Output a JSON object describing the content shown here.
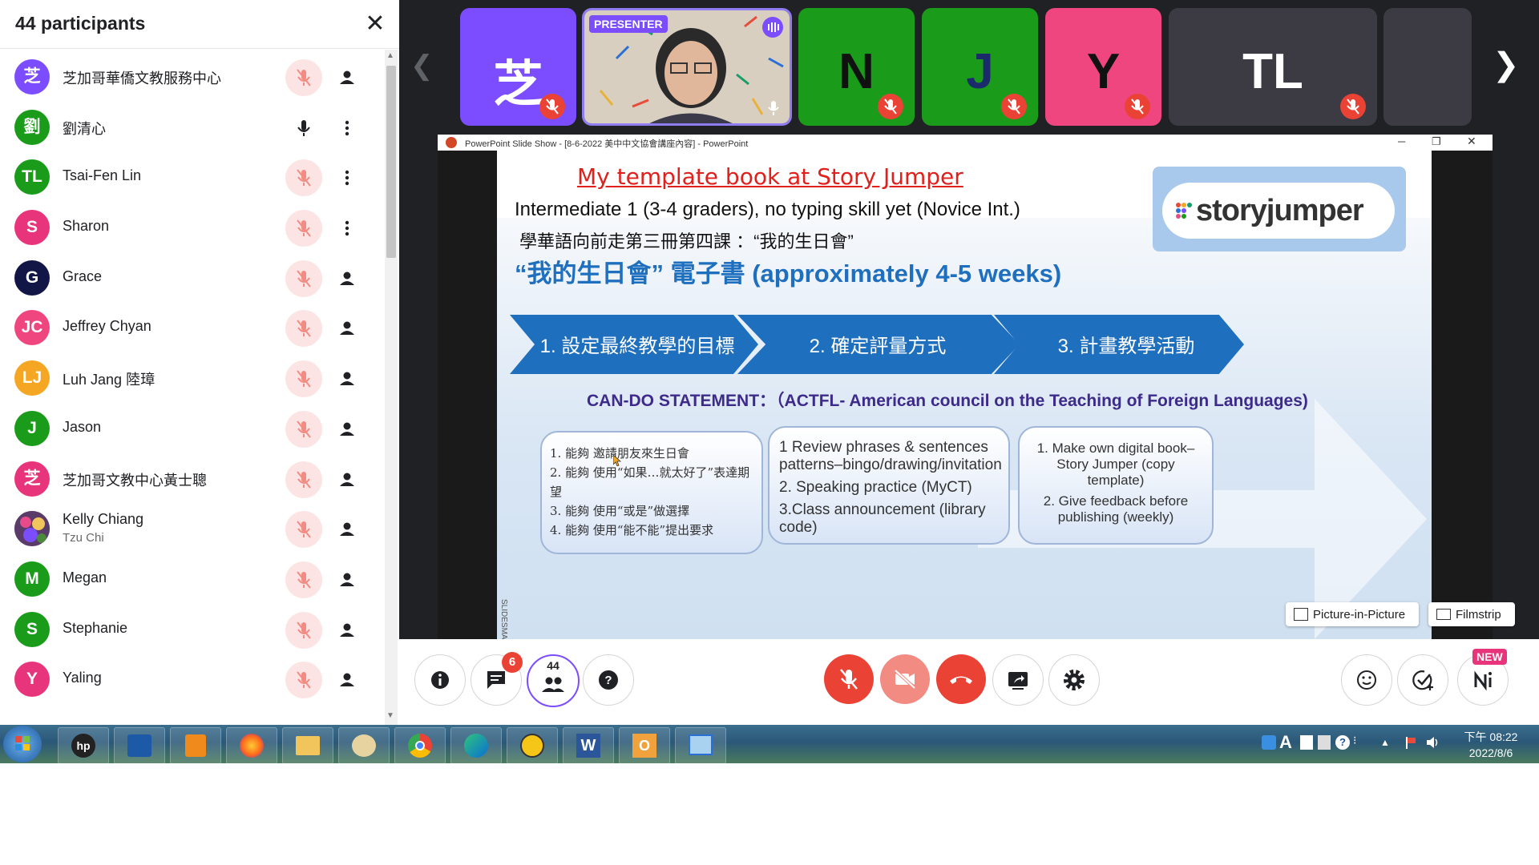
{
  "participants_panel": {
    "title": "44 participants",
    "participants": [
      {
        "initials": "芝",
        "name": "芝加哥華僑文教服務中心",
        "color": "#7c4dff",
        "muted": true,
        "action": "person"
      },
      {
        "initials": "劉",
        "name": "劉清心",
        "color": "#1a9b1a",
        "muted": false,
        "action": "more"
      },
      {
        "initials": "TL",
        "name": "Tsai-Fen Lin",
        "color": "#1a9b1a",
        "muted": true,
        "action": "more"
      },
      {
        "initials": "S",
        "name": "Sharon",
        "color": "#e8347a",
        "muted": true,
        "action": "more"
      },
      {
        "initials": "G",
        "name": "Grace",
        "color": "#111647",
        "muted": true,
        "action": "person"
      },
      {
        "initials": "JC",
        "name": "Jeffrey Chyan",
        "color": "#f0467f",
        "muted": true,
        "action": "person"
      },
      {
        "initials": "LJ",
        "name": "Luh Jang 陸璋",
        "color": "#f5a623",
        "muted": true,
        "action": "person"
      },
      {
        "initials": "J",
        "name": "Jason",
        "color": "#1a9b1a",
        "muted": true,
        "action": "person"
      },
      {
        "initials": "芝",
        "name": "芝加哥文教中心黃士聰",
        "color": "#e8347a",
        "muted": true,
        "action": "person"
      },
      {
        "initials": "",
        "name": "Kelly Chiang",
        "subtitle": "Tzu Chi",
        "color": "#6b4a7a",
        "muted": true,
        "action": "person",
        "photo": true
      },
      {
        "initials": "M",
        "name": "Megan",
        "color": "#1a9b1a",
        "muted": true,
        "action": "person"
      },
      {
        "initials": "S",
        "name": "Stephanie",
        "color": "#1a9b1a",
        "muted": true,
        "action": "person"
      },
      {
        "initials": "Y",
        "name": "Yaling",
        "color": "#e8347a",
        "muted": true,
        "action": "person"
      }
    ]
  },
  "filmstrip": {
    "tiles": [
      {
        "letter": "芝",
        "bg": "#7c4dff",
        "fg": "#ffffff",
        "muted": true
      },
      {
        "badge": "PRESENTER",
        "presenter": true
      },
      {
        "letter": "N",
        "bg": "#1a9b1a",
        "fg": "#111111",
        "muted": true
      },
      {
        "letter": "J",
        "bg": "#1a9b1a",
        "fg": "#1a2a6b",
        "muted": true
      },
      {
        "letter": "Y",
        "bg": "#f0467f",
        "fg": "#111111",
        "muted": true
      },
      {
        "letter": "TL",
        "bg": "#3c3b44",
        "fg": "#ffffff",
        "muted": true
      }
    ]
  },
  "ppt": {
    "window_title": "PowerPoint Slide Show - [8-6-2022 美中中文協會講座內容] - PowerPoint",
    "slide": {
      "heading": "My template book at Story Jumper",
      "line1": "Intermediate 1 (3-4 graders), no typing skill yet (Novice Int.)",
      "line2": "學華語向前走第三冊第四課 ：“我的生日會”",
      "line3": "“我的生日會” 電子書  (approximately 4-5 weeks)",
      "logo_text": "storyjumper",
      "steps": [
        "1. 設定最終教學的目標",
        "2. 確定評量方式",
        "3. 計畫教學活動"
      ],
      "can_do": "CAN-DO STATEMENT：（ACTFL- American council on the Teaching of Foreign Languages)",
      "box1": [
        "1. 能夠 邀請朋友來生日會",
        "2. 能夠 使用“如果…就太好了”表達期望",
        "3. 能夠 使用“或是”做選擇",
        "4. 能夠 使用“能不能”提出要求"
      ],
      "box2": [
        "1 Review phrases & sentences patterns–bingo/drawing/invitation",
        "2. Speaking practice (MyCT)",
        "3.Class announcement (library code)"
      ],
      "box3": [
        "1. Make own digital book–Story Jumper (copy template)",
        "2. Give feedback before publishing (weekly)"
      ],
      "side_label": "SLIDESMAN"
    }
  },
  "view_buttons": {
    "pip": "Picture-in-Picture",
    "filmstrip": "Filmstrip"
  },
  "controls": {
    "chat_badge": "6",
    "participants_count": "44",
    "new_badge": "NEW"
  },
  "taskbar": {
    "time": "下午 08:22",
    "date": "2022/8/6",
    "ime": "A"
  }
}
